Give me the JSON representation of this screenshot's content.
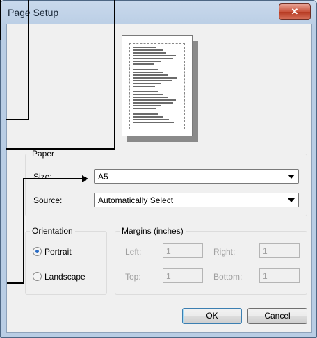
{
  "window": {
    "title": "Page Setup",
    "close_glyph": "✕"
  },
  "paper": {
    "legend": "Paper",
    "size_label": "Size:",
    "size_value": "A5",
    "source_label": "Source:",
    "source_value": "Automatically Select"
  },
  "orientation": {
    "legend": "Orientation",
    "portrait": "Portrait",
    "landscape": "Landscape",
    "selected": "Portrait"
  },
  "margins": {
    "legend": "Margins (inches)",
    "left_label": "Left:",
    "left_value": "1",
    "right_label": "Right:",
    "right_value": "1",
    "top_label": "Top:",
    "top_value": "1",
    "bottom_label": "Bottom:",
    "bottom_value": "1"
  },
  "buttons": {
    "ok": "OK",
    "cancel": "Cancel"
  },
  "colors": {
    "accent": "#2a6cc4",
    "close": "#c8523b"
  }
}
